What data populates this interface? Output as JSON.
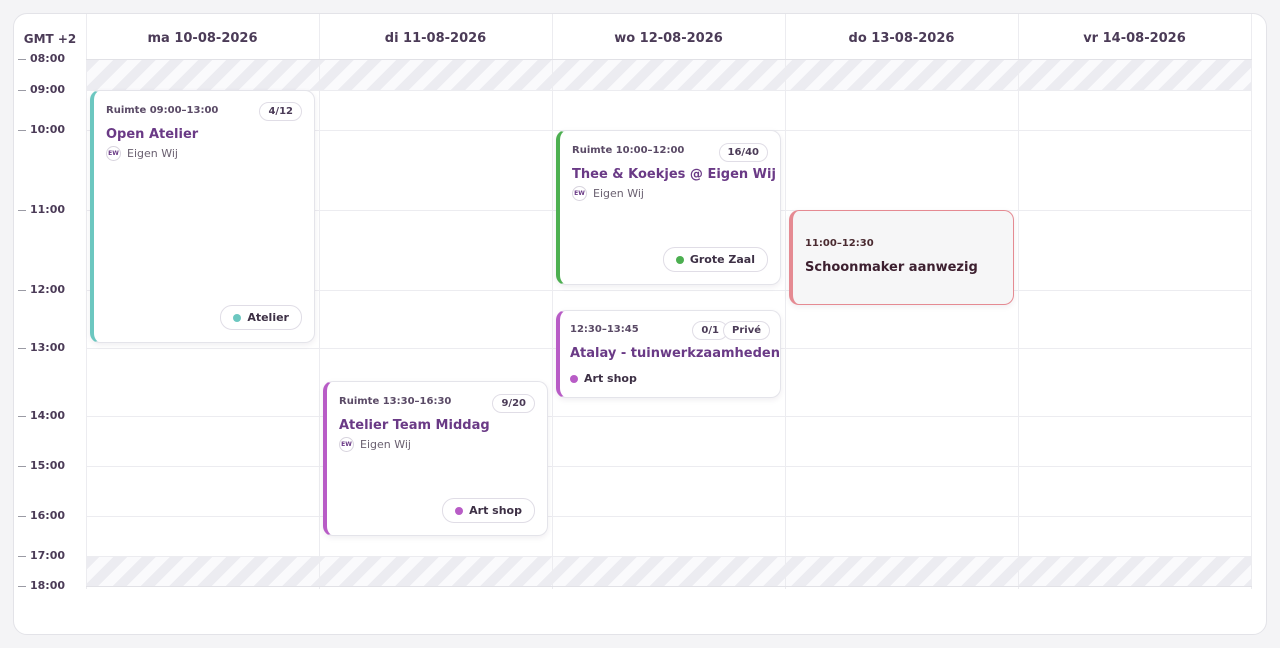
{
  "timezone": "GMT +2",
  "days": [
    {
      "label": "ma 10-08-2026"
    },
    {
      "label": "di 11-08-2026"
    },
    {
      "label": "wo 12-08-2026"
    },
    {
      "label": "do 13-08-2026"
    },
    {
      "label": "vr 14-08-2026"
    }
  ],
  "hours": [
    "08:00",
    "09:00",
    "10:00",
    "11:00",
    "12:00",
    "13:00",
    "14:00",
    "15:00",
    "16:00",
    "17:00",
    "18:00"
  ],
  "events": {
    "open_atelier": {
      "time": "Ruimte 09:00–13:00",
      "capacity": "4/12",
      "title": "Open Atelier",
      "org_initials": "EW",
      "org": "Eigen Wij",
      "room": "Atelier",
      "color": "#6cc7c0"
    },
    "thee_koekjes": {
      "time": "Ruimte 10:00–12:00",
      "capacity": "16/40",
      "title": "Thee & Koekjes @ Eigen Wij",
      "org_initials": "EW",
      "org": "Eigen Wij",
      "room": "Grote Zaal",
      "color": "#4caf50"
    },
    "atalay": {
      "time": "12:30–13:45",
      "capacity": "0/1",
      "private": "Privé",
      "title": "Atalay - tuinwerkzaamheden",
      "room": "Art shop",
      "color": "#b85cc6"
    },
    "atelier_team": {
      "time": "Ruimte 13:30–16:30",
      "capacity": "9/20",
      "title": "Atelier Team Middag",
      "org_initials": "EW",
      "org": "Eigen Wij",
      "room": "Art shop",
      "color": "#b85cc6"
    },
    "schoonmaker": {
      "time": "11:00–12:30",
      "title": "Schoonmaker aanwezig",
      "color": "#e58a92"
    }
  }
}
